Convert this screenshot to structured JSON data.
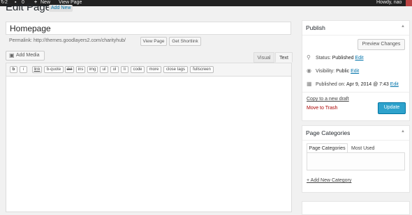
{
  "adminbar": {
    "comments_count": "2",
    "updates_count": "0",
    "new_label": "New",
    "view_page_label": "View Page",
    "howdy": "Howdy, nao"
  },
  "page": {
    "title": "Edit Page",
    "add_new": "Add New"
  },
  "editor": {
    "title_value": "Homepage",
    "permalink_label": "Permalink:",
    "permalink_url": "http://themes.goodlayers2.com/charityhub/",
    "view_page_btn": "View Page",
    "get_shortlink_btn": "Get Shortlink",
    "add_media": "Add Media",
    "tabs": [
      "Visual",
      "Text"
    ],
    "quicktags": [
      "b",
      "i",
      "link",
      "b-quote",
      "del",
      "ins",
      "img",
      "ul",
      "ol",
      "li",
      "code",
      "more",
      "close tags",
      "fullscreen"
    ]
  },
  "publish": {
    "title": "Publish",
    "preview_btn": "Preview Changes",
    "status_label": "Status:",
    "status_value": "Published",
    "visibility_label": "Visibility:",
    "visibility_value": "Public",
    "published_on_label": "Published on:",
    "published_on_value": "Apr 9, 2014 @ 7:43",
    "edit": "Edit",
    "copy_draft": "Copy to a new draft",
    "trash": "Move to Trash",
    "update": "Update"
  },
  "categories": {
    "title": "Page Categories",
    "tab_all": "Page Categories",
    "tab_most_used": "Most Used",
    "add_new": "+ Add New Category"
  }
}
